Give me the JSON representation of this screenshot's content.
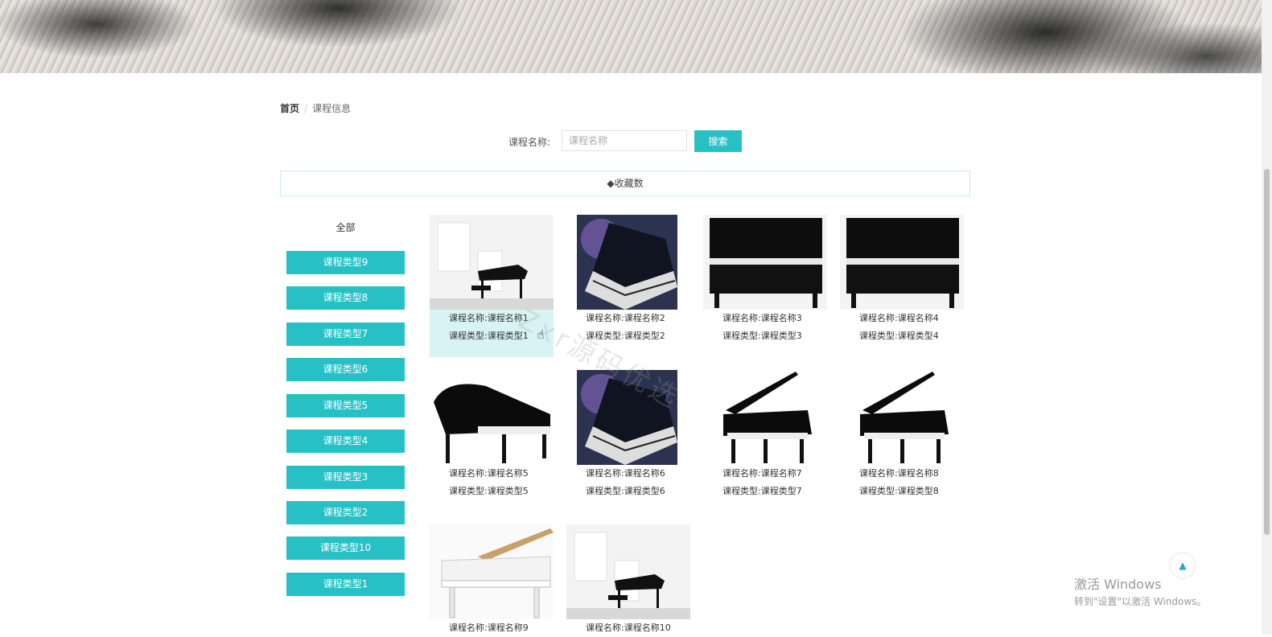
{
  "breadcrumb": {
    "home": "首页",
    "separator": "/",
    "current": "课程信息"
  },
  "search": {
    "label": "课程名称:",
    "placeholder": "课程名称",
    "button": "搜索"
  },
  "sort": {
    "label": "◆收藏数"
  },
  "categories": {
    "all": "全部",
    "items": [
      "课程类型9",
      "课程类型8",
      "课程类型7",
      "课程类型6",
      "课程类型5",
      "课程类型4",
      "课程类型3",
      "课程类型2",
      "课程类型10",
      "课程类型1"
    ]
  },
  "cards": [
    {
      "name_label": "课程名称:",
      "name": "课程名称1",
      "type_label": "课程类型:",
      "type": "课程类型1"
    },
    {
      "name_label": "课程名称:",
      "name": "课程名称2",
      "type_label": "课程类型:",
      "type": "课程类型2"
    },
    {
      "name_label": "课程名称:",
      "name": "课程名称3",
      "type_label": "课程类型:",
      "type": "课程类型3"
    },
    {
      "name_label": "课程名称:",
      "name": "课程名称4",
      "type_label": "课程类型:",
      "type": "课程类型4"
    },
    {
      "name_label": "课程名称:",
      "name": "课程名称5",
      "type_label": "课程类型:",
      "type": "课程类型5"
    },
    {
      "name_label": "课程名称:",
      "name": "课程名称6",
      "type_label": "课程类型:",
      "type": "课程类型6"
    },
    {
      "name_label": "课程名称:",
      "name": "课程名称7",
      "type_label": "课程类型:",
      "type": "课程类型7"
    },
    {
      "name_label": "课程名称:",
      "name": "课程名称8",
      "type_label": "课程类型:",
      "type": "课程类型8"
    },
    {
      "name_label": "课程名称:",
      "name": "课程名称9",
      "type_label": "",
      "type": ""
    },
    {
      "name_label": "课程名称:",
      "name": "课程名称10",
      "type_label": "",
      "type": ""
    }
  ],
  "windows": {
    "line1": "激活 Windows",
    "line2": "转到\"设置\"以激活 Windows。"
  },
  "watermark": "Zxr源码优选",
  "back_to_top_icon": "arrow-up-icon"
}
